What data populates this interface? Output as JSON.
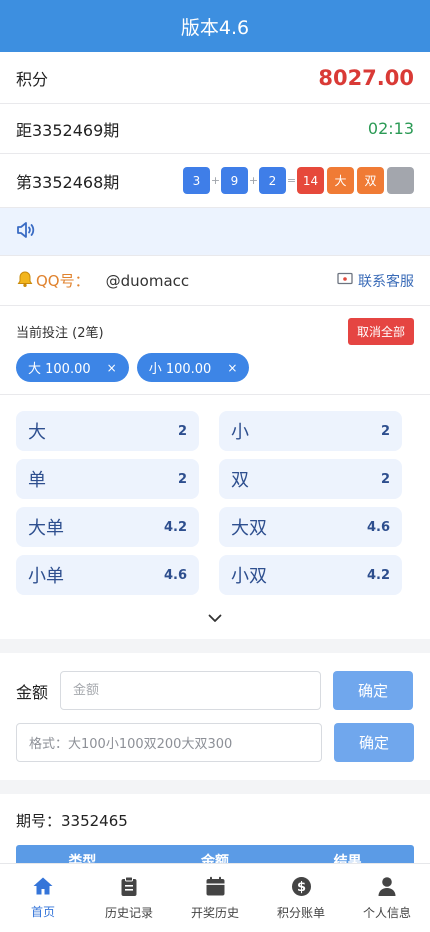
{
  "header": {
    "title": "版本4.6"
  },
  "score": {
    "label": "积分",
    "value": "8027.00"
  },
  "next_draw": {
    "label": "距3352469期",
    "countdown": "02:13"
  },
  "last_draw": {
    "label": "第3352468期",
    "balls": [
      "3",
      "9",
      "2"
    ],
    "ops": [
      "+",
      "+",
      "="
    ],
    "sum": "14",
    "size": "大",
    "parity": "双"
  },
  "contact": {
    "qq_label": "QQ号：",
    "qq_value": "@duomacc",
    "service_label": "联系客服"
  },
  "bets": {
    "title": "当前投注 (2笔)",
    "cancel_all": "取消全部",
    "chips": [
      {
        "label": "大 100.00",
        "remove": "×"
      },
      {
        "label": "小 100.00",
        "remove": "×"
      }
    ]
  },
  "options": [
    {
      "name": "大",
      "odds": "2"
    },
    {
      "name": "小",
      "odds": "2"
    },
    {
      "name": "单",
      "odds": "2"
    },
    {
      "name": "双",
      "odds": "2"
    },
    {
      "name": "大单",
      "odds": "4.2"
    },
    {
      "name": "大双",
      "odds": "4.6"
    },
    {
      "name": "小单",
      "odds": "4.6"
    },
    {
      "name": "小双",
      "odds": "4.2"
    }
  ],
  "amount": {
    "label": "金额",
    "placeholder": "金额",
    "confirm": "确定",
    "format_value": "格式：大100小100双200大双300",
    "format_confirm": "确定"
  },
  "issue": {
    "label": "期号：3352465"
  },
  "table": {
    "columns": [
      "类型",
      "金额",
      "结果"
    ]
  },
  "tabs": [
    {
      "label": "首页",
      "icon": "home-icon"
    },
    {
      "label": "历史记录",
      "icon": "clipboard-icon"
    },
    {
      "label": "开奖历史",
      "icon": "calendar-icon"
    },
    {
      "label": "积分账单",
      "icon": "dollar-icon"
    },
    {
      "label": "个人信息",
      "icon": "user-icon"
    }
  ],
  "colors": {
    "primary": "#3d8fe0",
    "score": "#d93a36",
    "countdown": "#2b9a55",
    "active_tab": "#3575d9"
  }
}
